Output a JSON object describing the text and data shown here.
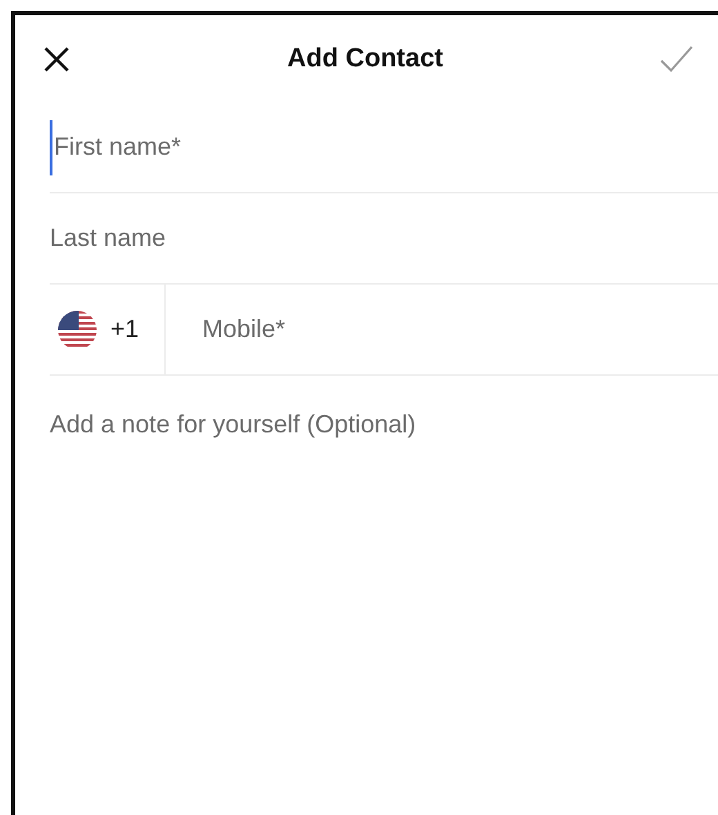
{
  "header": {
    "title": "Add Contact",
    "save_disabled": true
  },
  "fields": [
    {
      "kind": "text",
      "placeholder": "First name*",
      "focused": true
    },
    {
      "kind": "text",
      "placeholder": "Last name",
      "focused": false
    },
    {
      "kind": "phone",
      "country_code": "+1",
      "placeholder": "Mobile*",
      "focused": false
    }
  ],
  "note": {
    "placeholder": "Add a note for yourself (Optional)"
  }
}
